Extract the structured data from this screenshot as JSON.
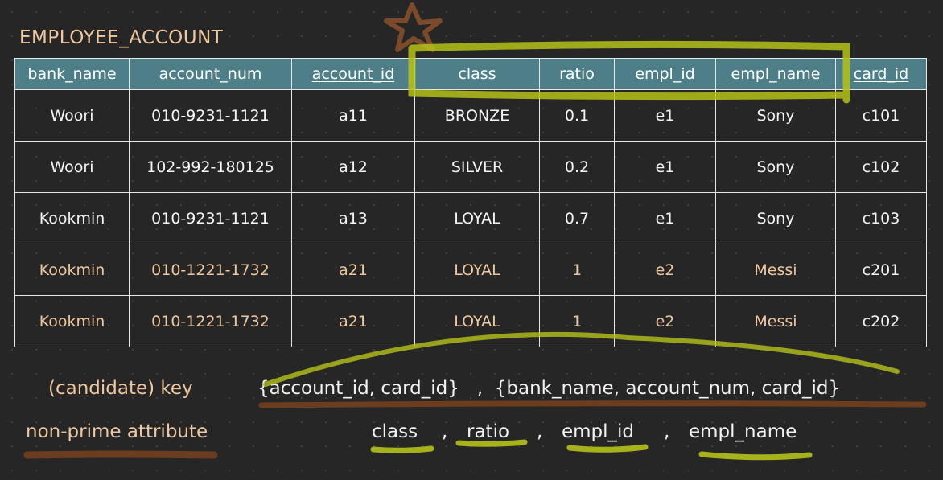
{
  "title": "EMPLOYEE_ACCOUNT",
  "table": {
    "columns": [
      {
        "label": "bank_name",
        "key": false
      },
      {
        "label": "account_num",
        "key": false
      },
      {
        "label": "account_id",
        "key": true
      },
      {
        "label": "class",
        "key": false
      },
      {
        "label": "ratio",
        "key": false
      },
      {
        "label": "empl_id",
        "key": false
      },
      {
        "label": "empl_name",
        "key": false
      },
      {
        "label": "card_id",
        "key": true
      }
    ],
    "rows": [
      {
        "cells": [
          "Woori",
          "010-9231-1121",
          "a11",
          "BRONZE",
          "0.1",
          "e1",
          "Sony",
          "c101"
        ],
        "accent": false
      },
      {
        "cells": [
          "Woori",
          "102-992-180125",
          "a12",
          "SILVER",
          "0.2",
          "e1",
          "Sony",
          "c102"
        ],
        "accent": false
      },
      {
        "cells": [
          "Kookmin",
          "010-9231-1121",
          "a13",
          "LOYAL",
          "0.7",
          "e1",
          "Sony",
          "c103"
        ],
        "accent": false
      },
      {
        "cells": [
          "Kookmin",
          "010-1221-1732",
          "a21",
          "LOYAL",
          "1",
          "e2",
          "Messi",
          "c201"
        ],
        "accent": true
      },
      {
        "cells": [
          "Kookmin",
          "010-1221-1732",
          "a21",
          "LOYAL",
          "1",
          "e2",
          "Messi",
          "c202"
        ],
        "accent": true
      }
    ]
  },
  "candidate_key": {
    "label": "(candidate) key",
    "value": "{account_id, card_id}   ,  {bank_name, account_num, card_id}"
  },
  "non_prime": {
    "label": "non-prime attribute",
    "items": [
      "class",
      ",",
      "ratio",
      ",",
      "empl_id",
      ",",
      "empl_name"
    ]
  },
  "colors": {
    "background": "#262626",
    "header_fill": "#4e7f89",
    "accent_text": "#f0c8a0",
    "highlight_green": "#b5c21a",
    "highlight_brown": "#6b3d1e"
  },
  "icons": [
    "star-doodle-icon"
  ]
}
